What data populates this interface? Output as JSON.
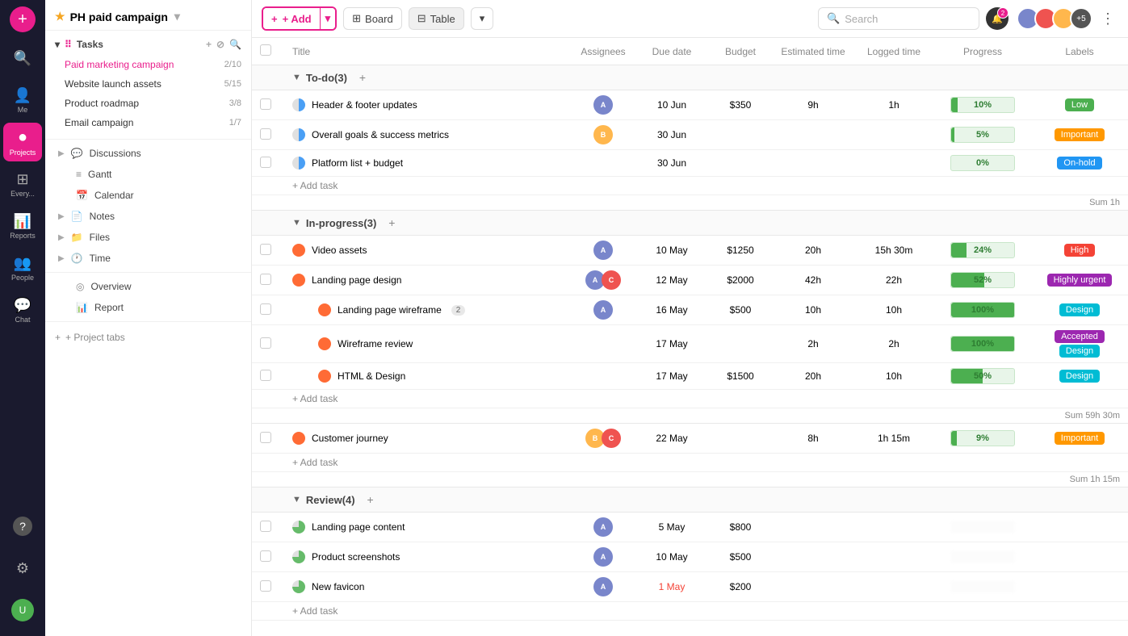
{
  "app": {
    "title": "PH paid campaign"
  },
  "iconbar": {
    "items": [
      {
        "id": "add",
        "icon": "+",
        "label": "",
        "active": false,
        "is_add": true
      },
      {
        "id": "search",
        "icon": "🔍",
        "label": "Search",
        "active": false
      },
      {
        "id": "me",
        "icon": "👤",
        "label": "Me",
        "active": false
      },
      {
        "id": "projects",
        "icon": "⬤",
        "label": "Projects",
        "active": true
      },
      {
        "id": "everything",
        "icon": "⊞",
        "label": "Everything",
        "active": false
      },
      {
        "id": "reports",
        "icon": "📊",
        "label": "Reports",
        "active": false
      },
      {
        "id": "people",
        "icon": "👥",
        "label": "People",
        "active": false
      },
      {
        "id": "chat",
        "icon": "💬",
        "label": "Chat",
        "active": false
      }
    ],
    "bottom": [
      {
        "id": "help",
        "icon": "?",
        "label": ""
      },
      {
        "id": "settings",
        "icon": "⚙",
        "label": ""
      },
      {
        "id": "avatar",
        "icon": "U",
        "label": ""
      }
    ]
  },
  "sidebar": {
    "project_name": "PH paid campaign",
    "tasks_section": "Tasks",
    "task_items": [
      {
        "label": "Paid marketing campaign",
        "count": "2/10",
        "active": true
      },
      {
        "label": "Website launch assets",
        "count": "5/15",
        "active": false
      },
      {
        "label": "Product roadmap",
        "count": "3/8",
        "active": false
      },
      {
        "label": "Email campaign",
        "count": "1/7",
        "active": false
      }
    ],
    "nav_items": [
      {
        "label": "Discussions",
        "icon": "💬",
        "has_arrow": true
      },
      {
        "label": "Gantt",
        "icon": "≡"
      },
      {
        "label": "Calendar",
        "icon": "📅"
      },
      {
        "label": "Notes",
        "icon": "📄",
        "has_arrow": true
      },
      {
        "label": "Files",
        "icon": "📁",
        "has_arrow": true
      },
      {
        "label": "Time",
        "icon": "🕐",
        "has_arrow": true
      }
    ],
    "bottom_nav": [
      {
        "label": "Overview",
        "icon": "◎"
      },
      {
        "label": "Report",
        "icon": "📊"
      }
    ],
    "add_tab_label": "+ Project tabs"
  },
  "toolbar": {
    "add_label": "+ Add",
    "board_label": "Board",
    "table_label": "Table",
    "search_placeholder": "Search",
    "more_label": "⋮",
    "notification_count": "2",
    "avatar_count": "+5"
  },
  "table": {
    "headers": [
      "",
      "Title",
      "Assignees",
      "Due date",
      "Budget",
      "Estimated time",
      "Logged time",
      "Progress",
      "Labels"
    ],
    "groups": [
      {
        "id": "todo",
        "label": "To-do",
        "count": 3,
        "expanded": true,
        "tasks": [
          {
            "id": 1,
            "title": "Header & footer updates",
            "status": "half",
            "assignees": [
              {
                "color": "#7986cb",
                "initials": "A"
              }
            ],
            "due_date": "10 Jun",
            "budget": "$350",
            "est_time": "9h",
            "logged_time": "1h",
            "progress": 10,
            "label": "Low",
            "label_type": "low",
            "indent": 0
          },
          {
            "id": 2,
            "title": "Overall goals & success metrics",
            "status": "half",
            "assignees": [
              {
                "color": "#ffb74d",
                "initials": "B"
              }
            ],
            "due_date": "30 Jun",
            "budget": "",
            "est_time": "",
            "logged_time": "",
            "progress": 5,
            "label": "Important",
            "label_type": "important",
            "indent": 0
          },
          {
            "id": 3,
            "title": "Platform list + budget",
            "status": "half",
            "assignees": [],
            "due_date": "30 Jun",
            "budget": "",
            "est_time": "",
            "logged_time": "",
            "progress": 0,
            "label": "On-hold",
            "label_type": "onhold",
            "indent": 0
          }
        ],
        "sum_label": "Sum 1h",
        "sum_col": "logged_time"
      },
      {
        "id": "inprogress",
        "label": "In-progress",
        "count": 3,
        "expanded": true,
        "tasks": [
          {
            "id": 4,
            "title": "Video assets",
            "status": "full",
            "assignees": [
              {
                "color": "#7986cb",
                "initials": "A"
              }
            ],
            "due_date": "10 May",
            "budget": "$1250",
            "est_time": "20h",
            "logged_time": "15h 30m",
            "progress": 24,
            "label": "High",
            "label_type": "high",
            "indent": 0
          },
          {
            "id": 5,
            "title": "Landing page design",
            "status": "full",
            "assignees": [
              {
                "color": "#7986cb",
                "initials": "A"
              },
              {
                "color": "#ef5350",
                "initials": "C"
              }
            ],
            "due_date": "12 May",
            "budget": "$2000",
            "est_time": "42h",
            "logged_time": "22h",
            "progress": 52,
            "label": "Highly urgent",
            "label_type": "highlyurgent",
            "indent": 0
          },
          {
            "id": 6,
            "title": "Landing page wireframe",
            "status": "full",
            "assignees": [
              {
                "color": "#7986cb",
                "initials": "A"
              }
            ],
            "due_date": "16 May",
            "budget": "$500",
            "est_time": "10h",
            "logged_time": "10h",
            "progress": 100,
            "label": "Design",
            "label_type": "design",
            "indent": 1,
            "badge": 2
          },
          {
            "id": 7,
            "title": "Wireframe review",
            "status": "full",
            "assignees": [],
            "due_date": "17 May",
            "budget": "",
            "est_time": "2h",
            "logged_time": "2h",
            "progress": 100,
            "label": "Accepted",
            "label_type": "accepted",
            "label2": "Design",
            "label2_type": "design",
            "indent": 1
          },
          {
            "id": 8,
            "title": "HTML & Design",
            "status": "full",
            "assignees": [],
            "due_date": "17 May",
            "budget": "$1500",
            "est_time": "20h",
            "logged_time": "10h",
            "progress": 50,
            "label": "Design",
            "label_type": "design",
            "indent": 1
          }
        ],
        "sum_label": "Sum 59h 30m",
        "sum_col": "logged_time"
      },
      {
        "id": "ungrouped",
        "label": null,
        "tasks": [
          {
            "id": 9,
            "title": "Customer journey",
            "status": "full",
            "assignees": [
              {
                "color": "#ffb74d",
                "initials": "B"
              },
              {
                "color": "#ef5350",
                "initials": "C"
              }
            ],
            "due_date": "22 May",
            "budget": "",
            "est_time": "8h",
            "logged_time": "1h 15m",
            "progress": 9,
            "label": "Important",
            "label_type": "important",
            "indent": 0
          }
        ],
        "sum_label": "Sum 1h 15m"
      },
      {
        "id": "review",
        "label": "Review",
        "count": 4,
        "expanded": true,
        "tasks": [
          {
            "id": 10,
            "title": "Landing page content",
            "status": "quarter",
            "assignees": [
              {
                "color": "#7986cb",
                "initials": "A"
              }
            ],
            "due_date": "5 May",
            "budget": "$800",
            "est_time": "",
            "logged_time": "",
            "progress": -1,
            "label": "",
            "label_type": "",
            "blurred": true,
            "indent": 0
          },
          {
            "id": 11,
            "title": "Product screenshots",
            "status": "quarter",
            "assignees": [
              {
                "color": "#7986cb",
                "initials": "A"
              }
            ],
            "due_date": "10 May",
            "budget": "$500",
            "est_time": "",
            "logged_time": "",
            "progress": -1,
            "label": "",
            "blurred": true,
            "indent": 0
          },
          {
            "id": 12,
            "title": "New favicon",
            "status": "quarter",
            "assignees": [
              {
                "color": "#7986cb",
                "initials": "A"
              }
            ],
            "due_date": "1 May",
            "due_date_red": true,
            "budget": "$200",
            "est_time": "",
            "logged_time": "",
            "progress": -1,
            "label": "",
            "blurred": true,
            "indent": 0
          }
        ]
      }
    ]
  }
}
